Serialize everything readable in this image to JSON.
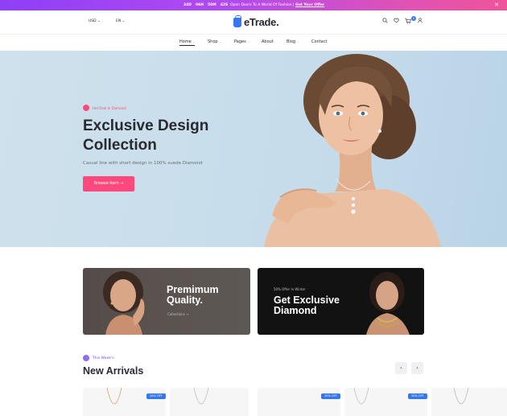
{
  "promo_bar": {
    "countdown": [
      "24D",
      "06H",
      "50M",
      "42S"
    ],
    "message": "Open Doors To A World Of Fashion",
    "separator": "|",
    "link": "Get Your Offer",
    "close_icon": "close-icon",
    "gradient": [
      "#8e3ff7",
      "#f0549a"
    ]
  },
  "header": {
    "currency": "USD",
    "language": "EN",
    "logo_text": "eTrade.",
    "icons": [
      "search-icon",
      "heart-icon",
      "cart-icon",
      "user-icon"
    ],
    "cart_count": "0"
  },
  "nav": {
    "items": [
      {
        "label": "Home",
        "dropdown": true,
        "active": true
      },
      {
        "label": "Shop",
        "dropdown": true
      },
      {
        "label": "Pages",
        "dropdown": true
      },
      {
        "label": "About",
        "dropdown": false
      },
      {
        "label": "Blog",
        "dropdown": true
      },
      {
        "label": "Contact",
        "dropdown": false
      }
    ]
  },
  "hero": {
    "kicker": "Hot Deal In Diamond",
    "title_line1": "Exclusive Design",
    "title_line2": "Collection",
    "subtitle": "Casual line with short design in 100% suede Diamond",
    "button": "Browse Item →",
    "accent": "#ff497c"
  },
  "cards": [
    {
      "title_line1": "Premimum",
      "title_line2": "Quality.",
      "link": "Collections →"
    },
    {
      "kicker": "50% Offer In Winter",
      "title_line1": "Get Exclusive",
      "title_line2": "Diamond"
    }
  ],
  "arrivals": {
    "kicker": "This Week's",
    "title": "New Arrivals",
    "prev": "‹",
    "next": "›",
    "badges": [
      "20% OFF",
      "10% OFF",
      "30% OFF"
    ],
    "badge_color": "#3577f0"
  }
}
